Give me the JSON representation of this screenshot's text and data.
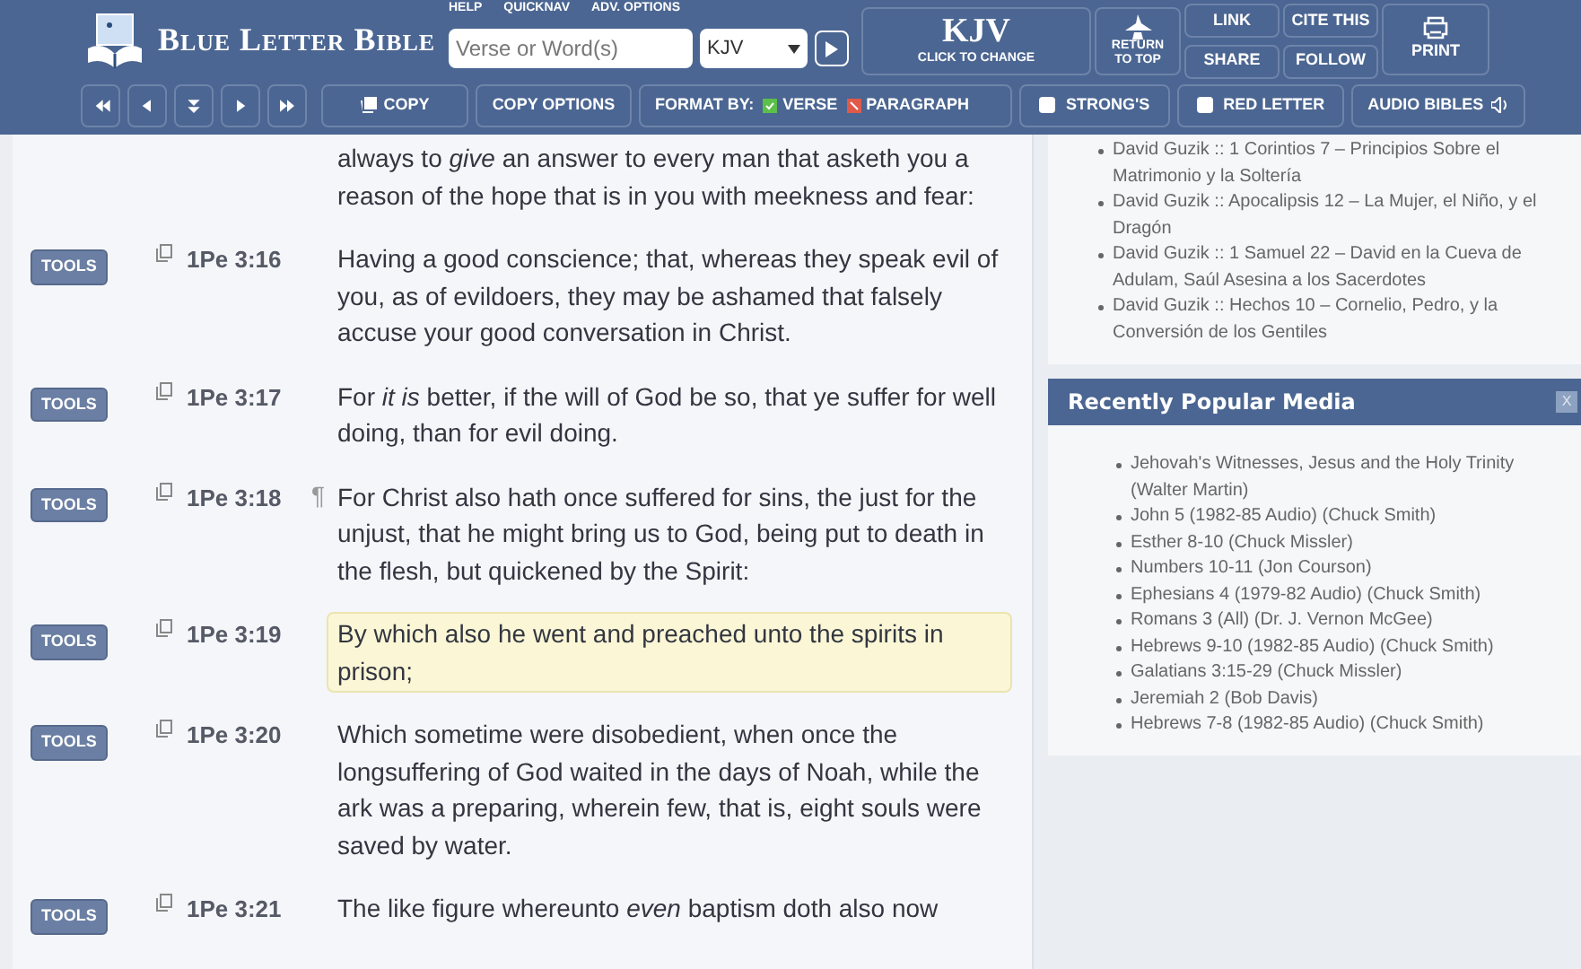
{
  "header": {
    "logo_text": "Blue Letter Bible",
    "top_links": [
      "HELP",
      "QUICKNAV",
      "ADV. OPTIONS"
    ],
    "search": {
      "placeholder": "Verse or Word(s)"
    },
    "version_select": {
      "value": "KJV"
    },
    "version_button": {
      "title": "KJV",
      "subtitle": "CLICK TO CHANGE"
    },
    "return_top": "RETURN TO TOP",
    "link_buttons": [
      "LINK",
      "CITE THIS",
      "SHARE",
      "FOLLOW"
    ],
    "print": "PRINT"
  },
  "toolbar": {
    "copy": "COPY",
    "copy_options": "COPY OPTIONS",
    "format_label": "FORMAT BY:",
    "format_options": [
      {
        "label": "VERSE",
        "selected": true
      },
      {
        "label": "PARAGRAPH",
        "selected": false
      }
    ],
    "toggles": [
      {
        "label": "STRONG'S",
        "checked": false
      },
      {
        "label": "RED LETTER",
        "checked": false
      }
    ],
    "audio": "AUDIO BIBLES"
  },
  "verses": [
    {
      "kind": "partial",
      "text": "always to *give* an answer to every man that asketh you a reason of the hope that is in you with meekness and fear:",
      "selected": false
    },
    {
      "kind": "full",
      "tools": "TOOLS",
      "ref": "1Pe 3:16",
      "text": "Having a good conscience; that, whereas they speak evil of you, as of evildoers, they may be ashamed that falsely accuse your good conversation in Christ.",
      "selected": false
    },
    {
      "kind": "full",
      "tools": "TOOLS",
      "ref": "1Pe 3:17",
      "text": "For *it is* better, if the will of God be so, that ye suffer for well doing, than for evil doing.",
      "selected": false
    },
    {
      "kind": "full",
      "tools": "TOOLS",
      "ref": "1Pe 3:18",
      "mark": "¶",
      "text": "For Christ also hath once suffered for sins, the just for the unjust, that he might bring us to God, being put to death in the flesh, but quickened by the Spirit:",
      "selected": false
    },
    {
      "kind": "full",
      "tools": "TOOLS",
      "ref": "1Pe 3:19",
      "text": "By which also he went and preached unto the spirits in prison;",
      "selected": true
    },
    {
      "kind": "full",
      "tools": "TOOLS",
      "ref": "1Pe 3:20",
      "text": "Which sometime were disobedient, when once the longsuffering of God waited in the days of Noah, while the ark was a preparing, wherein few, that is, eight souls were saved by water.",
      "selected": false
    },
    {
      "kind": "full",
      "tools": "TOOLS",
      "ref": "1Pe 3:21",
      "text": "The like figure whereunto *even* baptism doth also now",
      "selected": false
    }
  ],
  "sidebar": {
    "upper_list": [
      "David Guzik :: 1 Corintios 7 – Principios Sobre el Matrimonio y la Soltería",
      "David Guzik :: Apocalipsis 12 – La Mujer, el Niño, y el Dragón",
      "David Guzik :: 1 Samuel 22 – David en la Cueva de Adulam, Saúl Asesina a los Sacerdotes",
      "David Guzik :: Hechos 10 – Cornelio, Pedro, y la Conversión de los Gentiles"
    ],
    "media": {
      "title": "Recently Popular Media",
      "close": "X",
      "items": [
        "Jehovah's Witnesses, Jesus and the Holy Trinity (Walter Martin)",
        "John 5 (1982-85 Audio) (Chuck Smith)",
        "Esther 8-10 (Chuck Missler)",
        "Numbers 10-11 (Jon Courson)",
        "Ephesians 4 (1979-82 Audio) (Chuck Smith)",
        "Romans 3 (All) (Dr. J. Vernon McGee)",
        "Hebrews 9-10 (1982-85 Audio) (Chuck Smith)",
        "Galatians 3:15-29 (Chuck Missler)",
        "Jeremiah 2 (Bob Davis)",
        "Hebrews 7-8 (1982-85 Audio) (Chuck Smith)"
      ]
    }
  }
}
